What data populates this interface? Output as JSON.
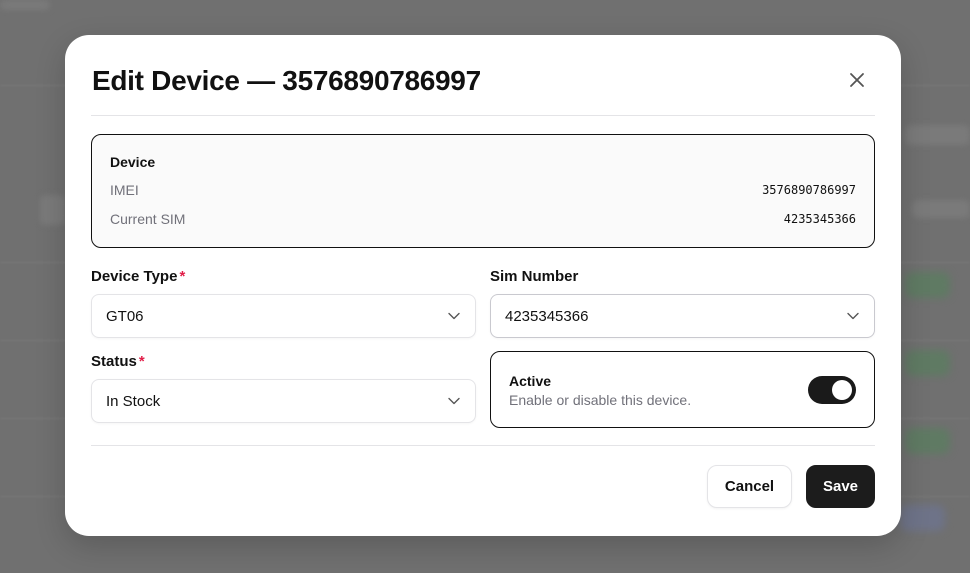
{
  "modal": {
    "title": "Edit Device — 3576890786997"
  },
  "device_info": {
    "heading": "Device",
    "imei_label": "IMEI",
    "imei_value": "3576890786997",
    "sim_label": "Current SIM",
    "sim_value": "4235345366"
  },
  "form": {
    "device_type": {
      "label": "Device Type",
      "required_mark": "*",
      "value": "GT06"
    },
    "sim_number": {
      "label": "Sim Number",
      "value": "4235345366"
    },
    "status": {
      "label": "Status",
      "required_mark": "*",
      "value": "In Stock"
    },
    "active": {
      "title": "Active",
      "description": "Enable or disable this device.",
      "enabled": true
    }
  },
  "actions": {
    "cancel_label": "Cancel",
    "save_label": "Save"
  },
  "icons": {
    "close": "close-icon",
    "chevron": "chevron-down-icon"
  },
  "colors": {
    "required": "#e11d48",
    "primary": "#1c1c1c",
    "overlay": "#707070"
  }
}
